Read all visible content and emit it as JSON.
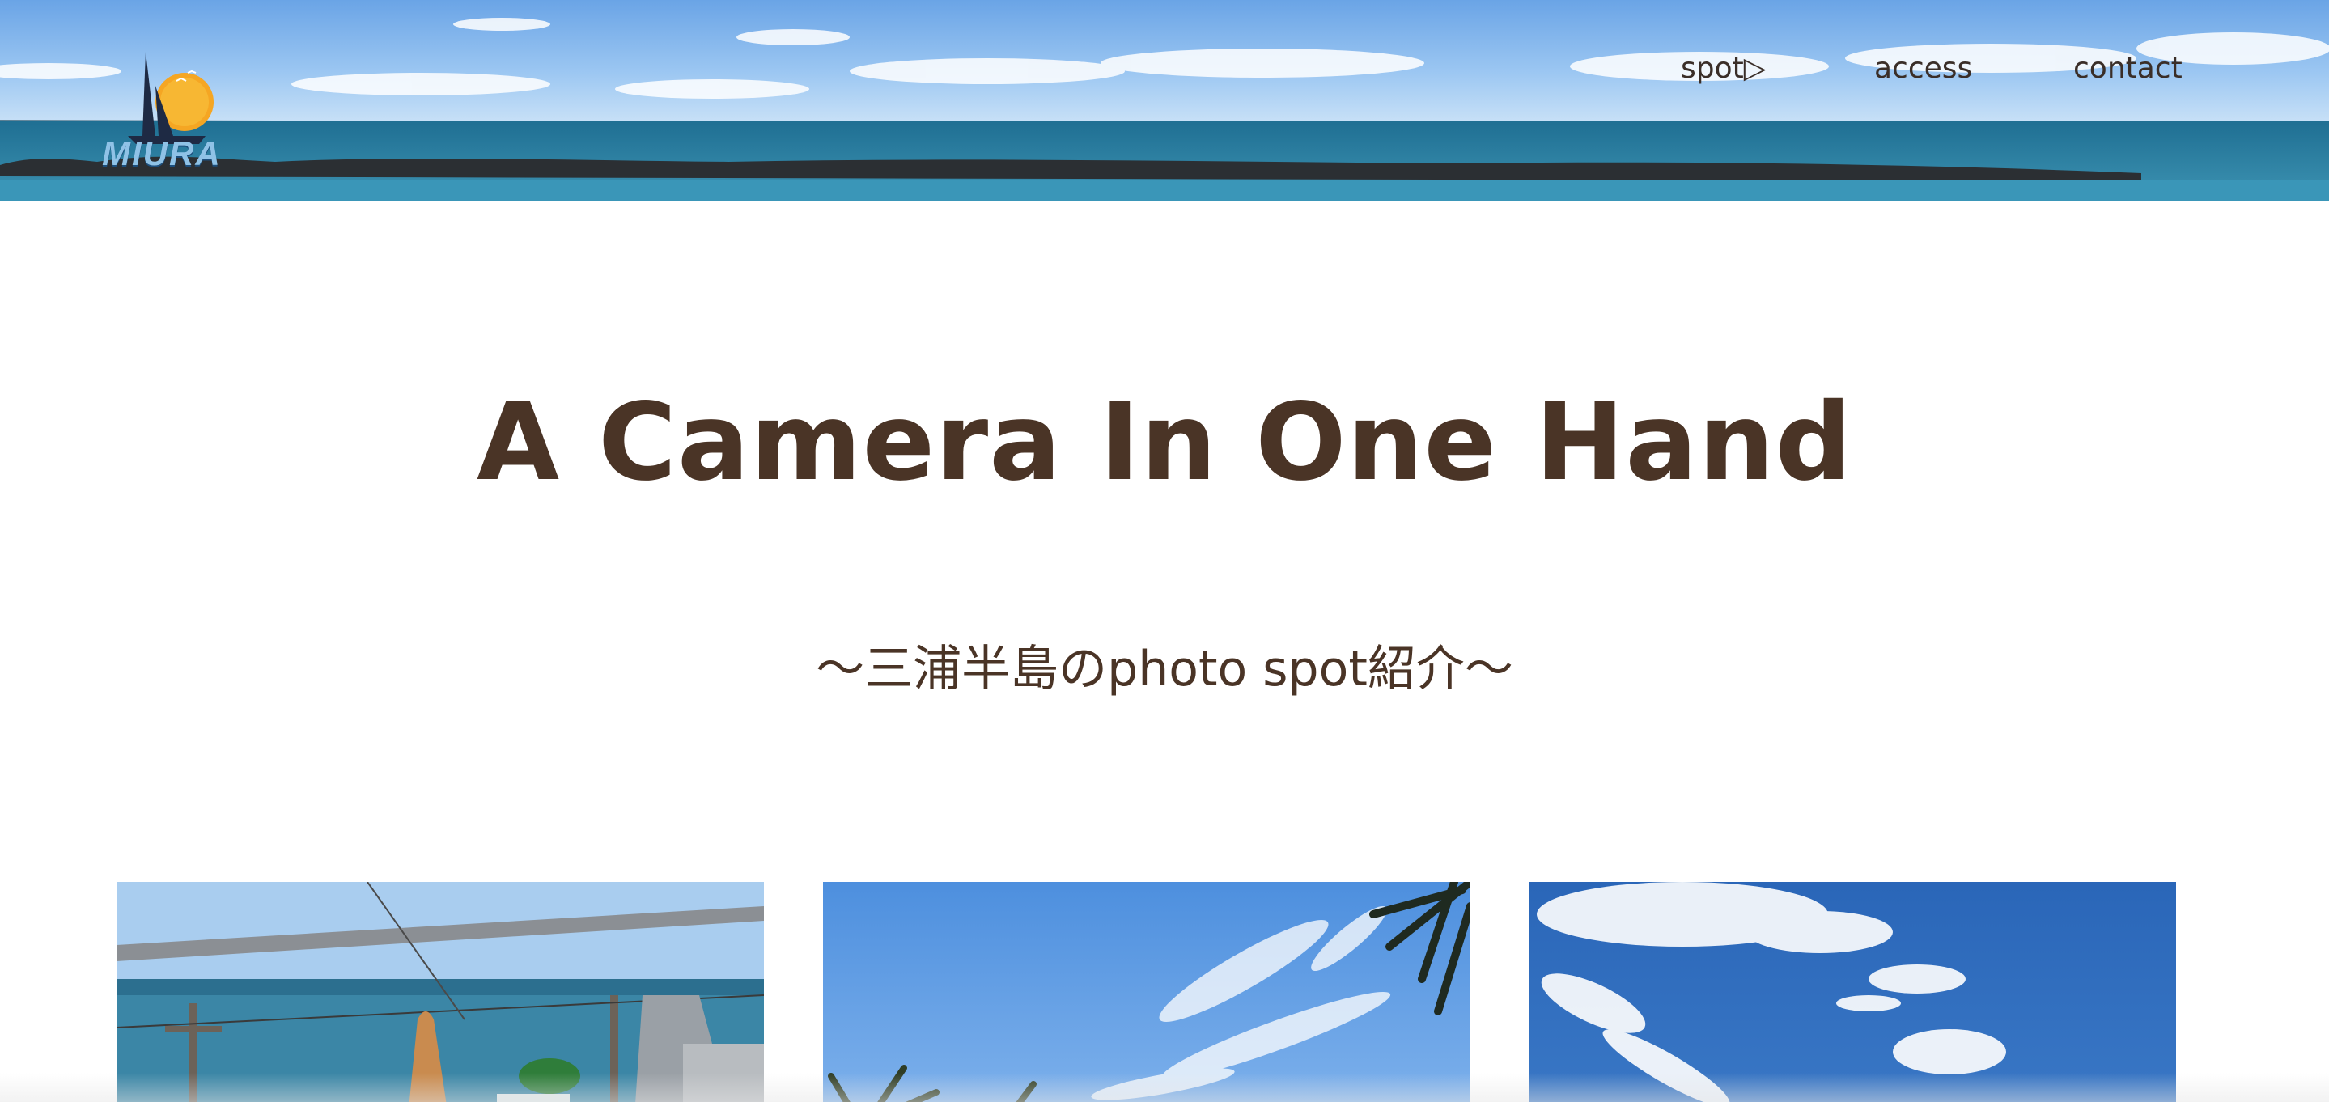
{
  "header": {
    "logo": {
      "text": "MIURA",
      "icon": "sailboat-sunset-logo"
    },
    "nav": [
      {
        "label": "spot▷",
        "id": "spot"
      },
      {
        "label": "access",
        "id": "access"
      },
      {
        "label": "contact",
        "id": "contact"
      }
    ]
  },
  "hero": {
    "title": "A Camera In One Hand",
    "subtitle": "〜三浦半島のphoto spot紹介〜"
  },
  "cards": [
    {
      "photo": "seaside-terrace-photo"
    },
    {
      "photo": "palm-sky-photo"
    },
    {
      "photo": "blue-sky-clouds-photo"
    }
  ],
  "colors": {
    "text": "#4a3426",
    "sky": "#86baf0",
    "sea": "#2f7fa3"
  }
}
